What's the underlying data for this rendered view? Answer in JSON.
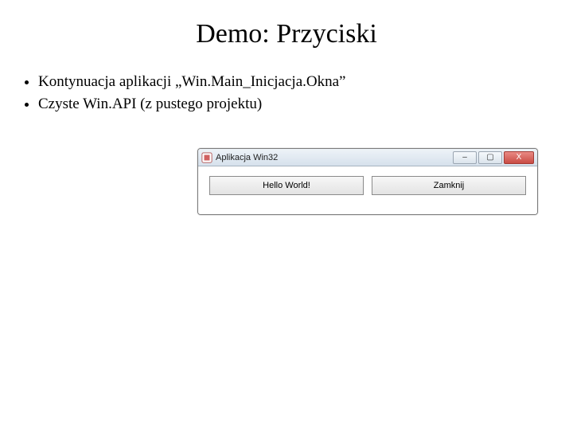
{
  "slide": {
    "title": "Demo: Przyciski",
    "bullets": [
      "Kontynuacja aplikacji „Win.Main_Inicjacja.Okna”",
      "Czyste Win.API (z pustego projektu)"
    ]
  },
  "app_window": {
    "title": "Aplikacja Win32",
    "buttons": {
      "hello": "Hello World!",
      "close_btn": "Zamknij"
    },
    "window_controls": {
      "minimize": "–",
      "maximize": "▢",
      "close": "X"
    }
  }
}
